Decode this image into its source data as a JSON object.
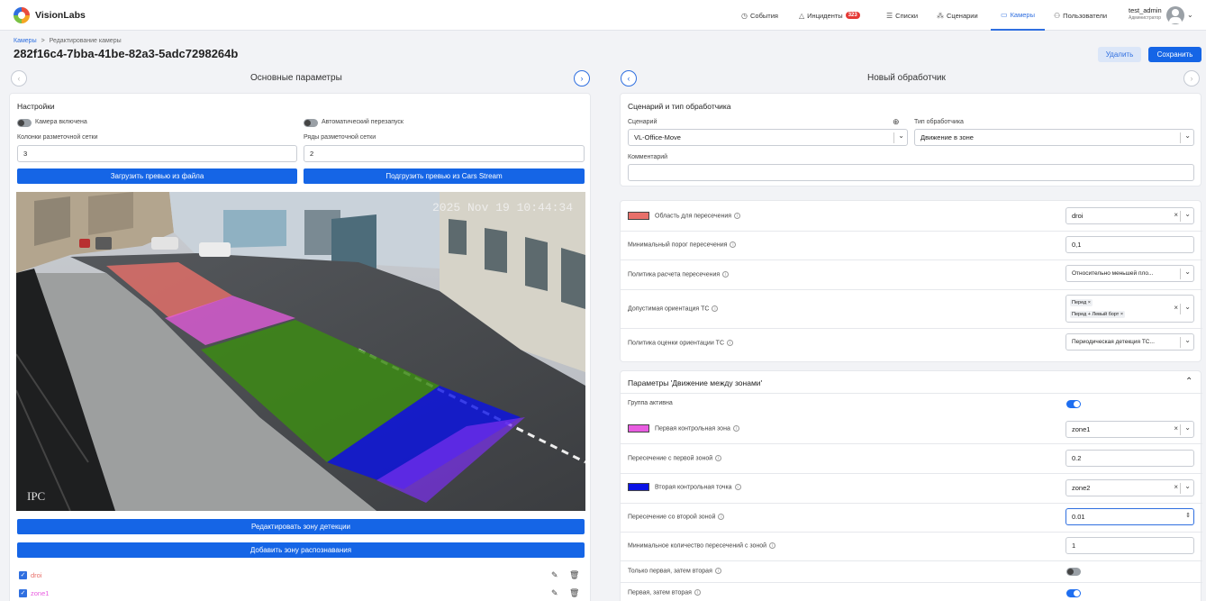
{
  "app": {
    "brand": "VisionLabs"
  },
  "nav": [
    {
      "label": "События",
      "icon": "clock-icon"
    },
    {
      "label": "Инциденты",
      "icon": "warning-icon",
      "badge": "323"
    },
    {
      "label": "Списки",
      "icon": "list-icon"
    },
    {
      "label": "Сценарии",
      "icon": "scenario-icon"
    },
    {
      "label": "Камеры",
      "icon": "camera-icon",
      "active": true
    },
    {
      "label": "Пользователи",
      "icon": "users-icon"
    }
  ],
  "user": {
    "name": "test_admin",
    "role": "Администратор"
  },
  "breadcrumb": {
    "root": "Камеры",
    "separator": ">",
    "current": "Редактирование камеры"
  },
  "page": {
    "title": "282f16c4-7bba-41be-82a3-5adc7298264b"
  },
  "actions": {
    "delete": "Удалить",
    "save": "Сохранить"
  },
  "left": {
    "section_title": "Основные параметры",
    "card_title": "Настройки",
    "camera_enabled": "Камера включена",
    "auto_restart": "Автоматический перезапуск",
    "grid_cols_label": "Колонки разметочной сетки",
    "grid_cols_value": "3",
    "grid_rows_label": "Ряды разметочной сетки",
    "grid_rows_value": "2",
    "upload_file_btn": "Загрузить превью из файла",
    "load_stream_btn": "Подгрузить превью из Cars Stream",
    "preview_timestamp": "2025 Nov 19 10:44:34",
    "preview_camera_label": "IPC",
    "edit_zone_btn": "Редактировать зону детекции",
    "add_zone_btn": "Добавить зону распознавания",
    "zones": [
      {
        "name": "droi",
        "color": "#e8706a"
      },
      {
        "name": "zone1",
        "color": "#e85ce0"
      }
    ]
  },
  "right": {
    "section_title": "Новый обработчик",
    "card1_title": "Сценарий и тип обработчика",
    "scenario_label": "Сценарий",
    "scenario_value": "VL-Office-Move",
    "handler_type_label": "Тип обработчика",
    "handler_type_value": "Движение в зоне",
    "comment_label": "Комментарий",
    "comment_value": "",
    "rows": [
      {
        "label": "Область для пересечения",
        "value": "droi",
        "kind": "select",
        "swatch": "#e8706a"
      },
      {
        "label": "Минимальный порог пересечения",
        "value": "0,1",
        "kind": "input"
      },
      {
        "label": "Политика расчета пересечения",
        "value": "Относительно меньшей пло...",
        "kind": "select"
      },
      {
        "label": "Допустимая ориентация ТС",
        "chips": [
          "Перед",
          "Перед + Левый борт"
        ],
        "kind": "multiselect"
      },
      {
        "label": "Политика оценки ориентации ТС",
        "value": "Периодическая детекция ТС...",
        "kind": "select"
      }
    ],
    "group_title": "Параметры 'Движение между зонами'",
    "group_rows": [
      {
        "label": "Группа активна",
        "kind": "toggle",
        "on": true
      },
      {
        "label": "Первая контрольная зона",
        "value": "zone1",
        "kind": "select",
        "swatch": "#e85ce0"
      },
      {
        "label": "Пересечение с первой зоной",
        "value": "0.2",
        "kind": "input"
      },
      {
        "label": "Вторая контрольная точка",
        "value": "zone2",
        "kind": "select",
        "swatch": "#0a12e6"
      },
      {
        "label": "Пересечение со второй зоной",
        "value": "0.01",
        "kind": "input-focus"
      },
      {
        "label": "Минимальное количество пересечений с зоной",
        "value": "1",
        "kind": "input"
      },
      {
        "label": "Только первая, затем вторая",
        "kind": "toggle",
        "on": false
      },
      {
        "label": "Первая, затем вторая",
        "kind": "toggle",
        "on": true
      }
    ]
  }
}
